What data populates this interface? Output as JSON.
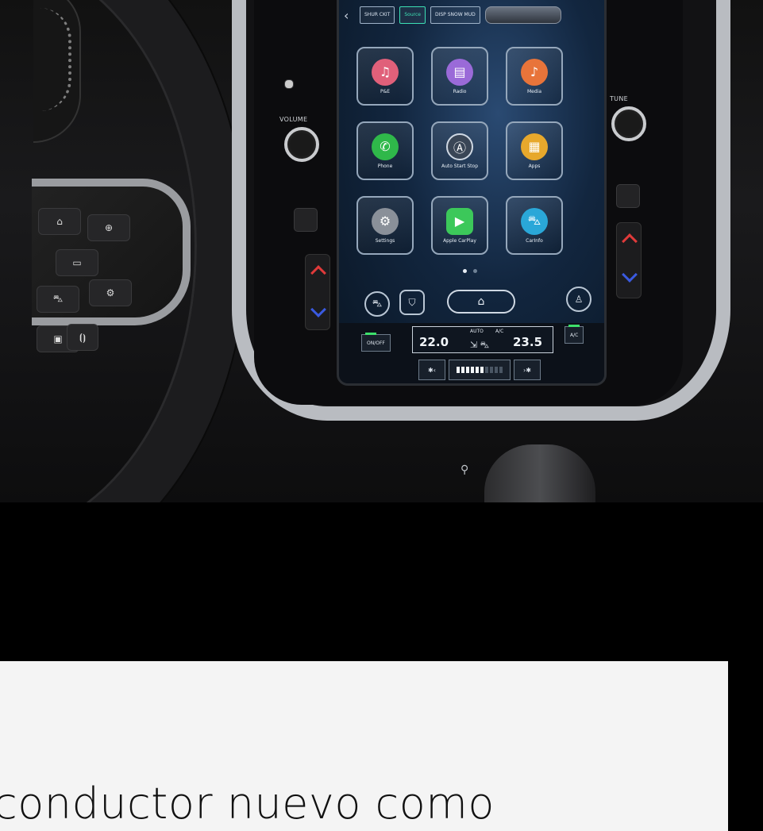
{
  "screen": {
    "topbar": {
      "buttons": [
        {
          "label": "SHUR\nCKIT"
        },
        {
          "label": "Source"
        },
        {
          "label": "DISP SNOW\nMUD"
        }
      ]
    },
    "apps": [
      {
        "label": "P&E",
        "icon": "music-note-icon",
        "color": "#e0607a"
      },
      {
        "label": "Radio",
        "icon": "radio-icon",
        "color": "#9a6ad8"
      },
      {
        "label": "Media",
        "icon": "music-note-icon",
        "color": "#e8743a"
      },
      {
        "label": "Phone",
        "icon": "phone-icon",
        "color": "#2fb84a"
      },
      {
        "label": "Auto\nStart Stop",
        "icon": "auto-stop-icon",
        "color": "#3a4656"
      },
      {
        "label": "Apps",
        "icon": "apps-icon",
        "color": "#e7a82c"
      },
      {
        "label": "Settings",
        "icon": "gear-icon",
        "color": "#8a9099"
      },
      {
        "label": "Apple\nCarPlay",
        "icon": "carplay-icon",
        "color": "#3cc85a"
      },
      {
        "label": "CarInfo",
        "icon": "car-icon",
        "color": "#2aa7d8"
      }
    ],
    "climate": {
      "on_off": "ON/OFF",
      "ac": "A/C",
      "auto": "AUTO",
      "ac_small": "A/C",
      "temp_left": "22.0",
      "temp_right": "23.5",
      "fan_level": 0.6
    }
  },
  "controls": {
    "volume_label": "VOLUME",
    "tune_label": "TUNE"
  },
  "caption": {
    "text": "conductor nuevo como"
  }
}
